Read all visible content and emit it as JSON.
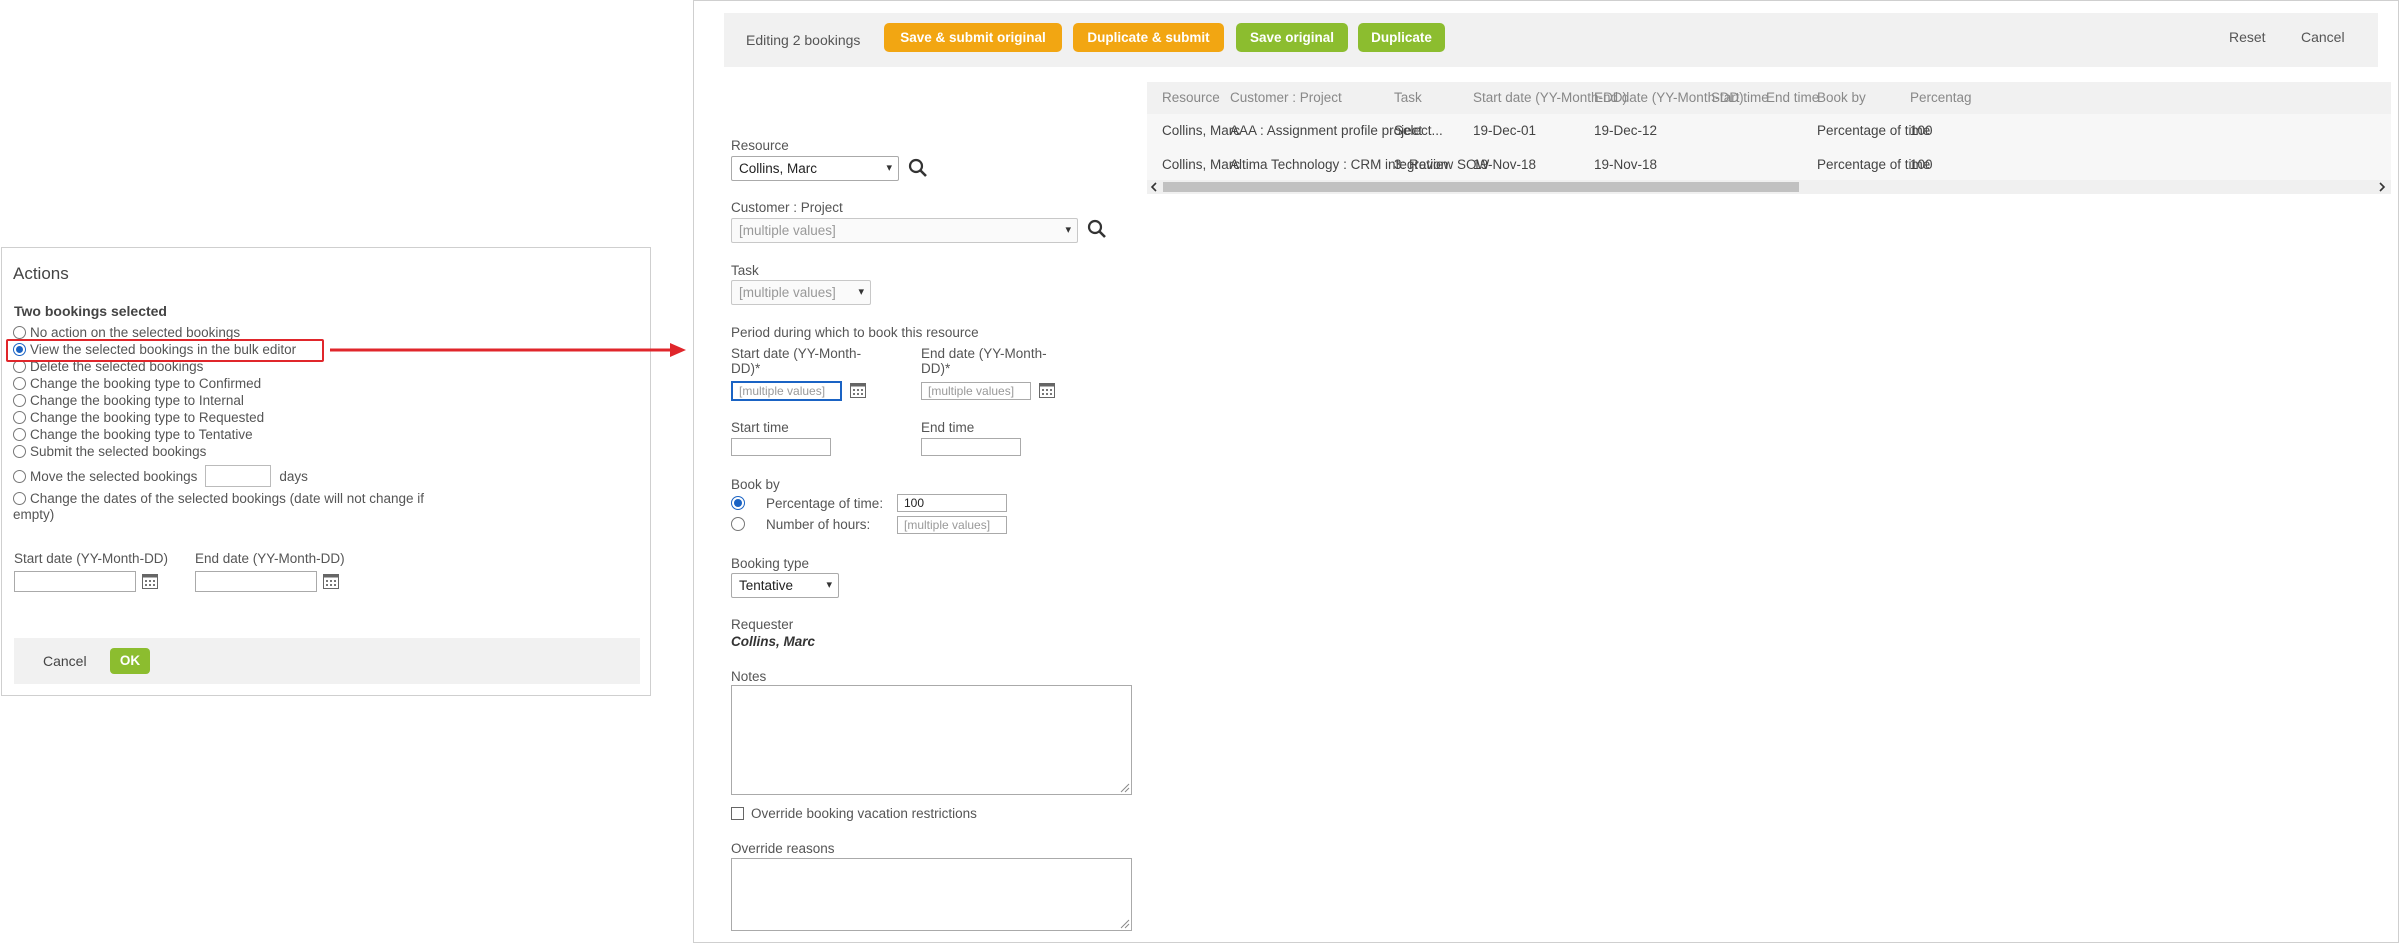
{
  "actions": {
    "title": "Actions",
    "subtitle": "Two bookings selected",
    "options": [
      "No action on the selected bookings",
      "View the selected bookings in the bulk editor",
      "Delete the selected bookings",
      "Change the booking type to Confirmed",
      "Change the booking type to Internal",
      "Change the booking type to Requested",
      "Change the booking type to Tentative",
      "Submit the selected bookings",
      "Move the selected bookings",
      "Change the dates of the selected bookings (date will not change if",
      "empty)"
    ],
    "selected_option": "View the selected bookings in the bulk editor",
    "move_days_suffix": "days",
    "start_date_label": "Start date (YY-Month-DD)",
    "end_date_label": "End date (YY-Month-DD)",
    "cancel_label": "Cancel",
    "ok_label": "OK"
  },
  "editor": {
    "editing_label": "Editing 2 bookings",
    "buttons": {
      "save_submit_original": "Save & submit original",
      "duplicate_submit": "Duplicate & submit",
      "save_original": "Save original",
      "duplicate": "Duplicate"
    },
    "reset_label": "Reset",
    "cancel_label": "Cancel",
    "resource_label": "Resource",
    "resource_value": "Collins, Marc",
    "customer_project_label": "Customer : Project",
    "customer_project_value": "[multiple values]",
    "task_label": "Task",
    "task_value": "[multiple values]",
    "period_label": "Period during which to book this resource",
    "start_date_label_line1": "Start date (YY-Month-",
    "start_date_label_line2": "DD)*",
    "end_date_label_line1": "End date (YY-Month-",
    "end_date_label_line2": "DD)*",
    "start_date_placeholder": "[multiple values]",
    "end_date_placeholder": "[multiple values]",
    "start_time_label": "Start time",
    "end_time_label": "End time",
    "book_by_label": "Book by",
    "percentage_label": "Percentage of time:",
    "percentage_value": "100",
    "hours_label": "Number of hours:",
    "hours_placeholder": "[multiple values]",
    "book_by_selected": "Percentage of time",
    "booking_type_label": "Booking type",
    "booking_type_value": "Tentative",
    "requester_label": "Requester",
    "requester_value": "Collins, Marc",
    "notes_label": "Notes",
    "override_label": "Override booking vacation restrictions",
    "override_reasons_label": "Override reasons"
  },
  "grid": {
    "columns": [
      "Resource",
      "Customer : Project",
      "Task",
      "Start date (YY-Month-DD)",
      "End date (YY-Month-DD)",
      "Start time",
      "End time",
      "Book by",
      "Percentag"
    ],
    "rows": [
      [
        "Collins, Marc",
        "AAA : Assignment profile project",
        "Select...",
        "19-Dec-01",
        "19-Dec-12",
        "",
        "",
        "Percentage of time",
        "100"
      ],
      [
        "Collins, Marc",
        "Altima Technology : CRM integration",
        "3: Review SOW",
        "19-Nov-18",
        "19-Nov-18",
        "",
        "",
        "Percentage of time",
        "100"
      ]
    ]
  },
  "colors": {
    "accent_orange": "#f2a612",
    "accent_green": "#8cbd2f",
    "highlight_red": "#e0262b",
    "radio_blue": "#1a63c4"
  }
}
